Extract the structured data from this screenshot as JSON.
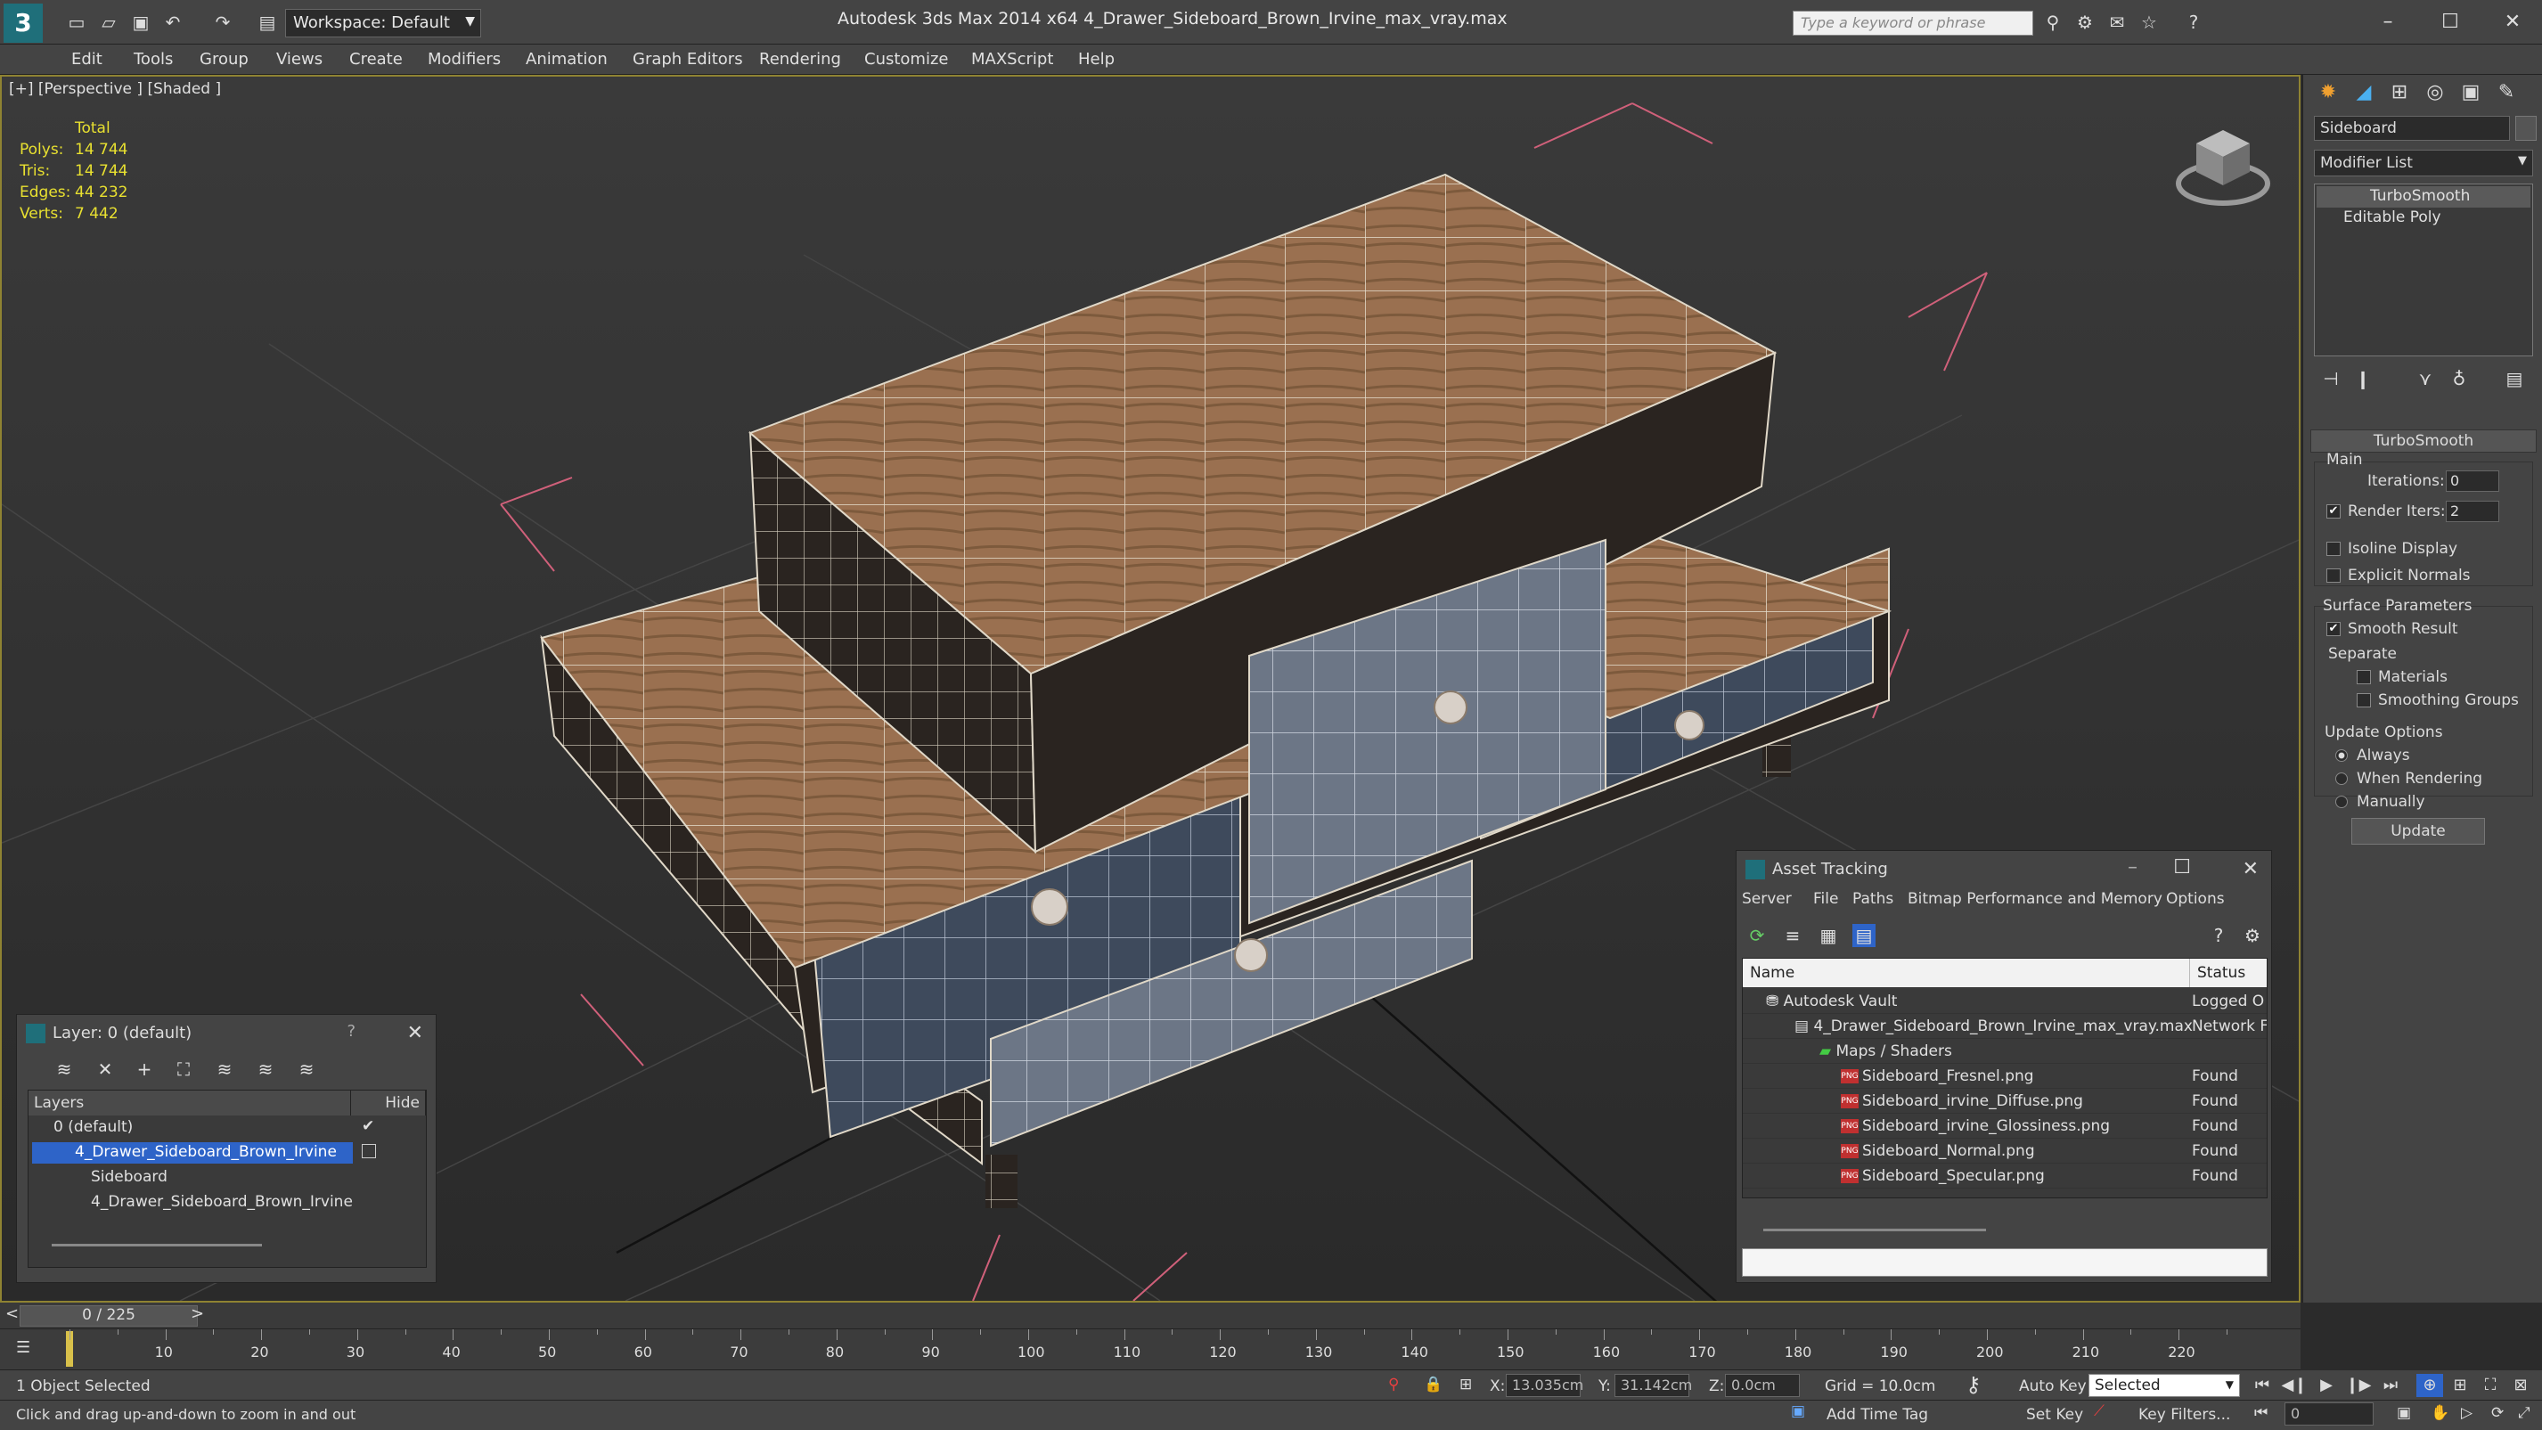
{
  "titlebar": {
    "workspace": "Workspace: Default",
    "title": "Autodesk 3ds Max  2014 x64     4_Drawer_Sideboard_Brown_Irvine_max_vray.max",
    "search_placeholder": "Type a keyword or phrase"
  },
  "menu": [
    "Edit",
    "Tools",
    "Group",
    "Views",
    "Create",
    "Modifiers",
    "Animation",
    "Graph Editors",
    "Rendering",
    "Customize",
    "MAXScript",
    "Help"
  ],
  "viewport": {
    "label": "[+] [Perspective ] [Shaded ]",
    "stats": {
      "header": "Total",
      "rows": [
        {
          "label": "Polys:",
          "value": "14 744"
        },
        {
          "label": "Tris:",
          "value": "14 744"
        },
        {
          "label": "Edges:",
          "value": "44 232"
        },
        {
          "label": "Verts:",
          "value": "7 442"
        }
      ]
    }
  },
  "layer_panel": {
    "title": "Layer: 0 (default)",
    "help": "?",
    "col_layers": "Layers",
    "col_hide": "Hide",
    "rows": [
      {
        "name": "0 (default)",
        "indent": 0,
        "selected": false
      },
      {
        "name": "4_Drawer_Sideboard_Brown_Irvine",
        "indent": 0,
        "selected": true
      },
      {
        "name": "Sideboard",
        "indent": 1,
        "selected": false
      },
      {
        "name": "4_Drawer_Sideboard_Brown_Irvine",
        "indent": 1,
        "selected": false
      }
    ]
  },
  "asset_panel": {
    "title": "Asset Tracking",
    "menu": [
      "Server",
      "File",
      "Paths",
      "Bitmap Performance and Memory",
      "Options"
    ],
    "col_name": "Name",
    "col_status": "Status",
    "rows": [
      {
        "name": "Autodesk Vault",
        "status": "Logged O",
        "indent": 1,
        "icon": "vault"
      },
      {
        "name": "4_Drawer_Sideboard_Brown_Irvine_max_vray.max",
        "status": "Network F",
        "indent": 2,
        "icon": "max"
      },
      {
        "name": "Maps / Shaders",
        "status": "",
        "indent": 3,
        "icon": "folder"
      },
      {
        "name": "Sideboard_Fresnel.png",
        "status": "Found",
        "indent": 4,
        "icon": "png"
      },
      {
        "name": "Sideboard_irvine_Diffuse.png",
        "status": "Found",
        "indent": 4,
        "icon": "png"
      },
      {
        "name": "Sideboard_irvine_Glossiness.png",
        "status": "Found",
        "indent": 4,
        "icon": "png"
      },
      {
        "name": "Sideboard_Normal.png",
        "status": "Found",
        "indent": 4,
        "icon": "png"
      },
      {
        "name": "Sideboard_Specular.png",
        "status": "Found",
        "indent": 4,
        "icon": "png"
      }
    ]
  },
  "command_panel": {
    "object_name": "Sideboard",
    "modifier_list": "Modifier List",
    "stack": [
      "TurboSmooth",
      "Editable Poly"
    ],
    "turbosmooth": {
      "title": "TurboSmooth",
      "main": "Main",
      "iterations_label": "Iterations:",
      "iterations": "0",
      "render_iters_label": "Render Iters:",
      "render_iters": "2",
      "isoline": "Isoline Display",
      "explicit": "Explicit Normals",
      "surface_params": "Surface Parameters",
      "smooth_result": "Smooth Result",
      "separate": "Separate",
      "materials": "Materials",
      "smoothing_groups": "Smoothing Groups",
      "update_options": "Update Options",
      "always": "Always",
      "when_rendering": "When Rendering",
      "manually": "Manually",
      "update": "Update"
    }
  },
  "timeline": {
    "frame": "0 / 225",
    "ticks": [
      "10",
      "20",
      "30",
      "40",
      "50",
      "60",
      "70",
      "80",
      "90",
      "100",
      "110",
      "120",
      "130",
      "140",
      "150",
      "160",
      "170",
      "180",
      "190",
      "200",
      "210",
      "220"
    ]
  },
  "status": {
    "selected": "1 Object Selected",
    "prompt": "Click and drag up-and-down to zoom in and out",
    "x_label": "X:",
    "x": "13.035cm",
    "y_label": "Y:",
    "y": "31.142cm",
    "z_label": "Z:",
    "z": "0.0cm",
    "grid": "Grid = 10.0cm",
    "auto_key": "Auto Key",
    "set_key": "Set Key",
    "selected_dropdown": "Selected",
    "key_filters": "Key Filters...",
    "add_time_tag": "Add Time Tag",
    "frame_field": "0"
  },
  "colors": {
    "accent": "#2e64c8",
    "viewport_border": "#8f8332",
    "stats": "#e8e030",
    "wood": "#9a7050",
    "drawer": "#3e4a5c"
  }
}
